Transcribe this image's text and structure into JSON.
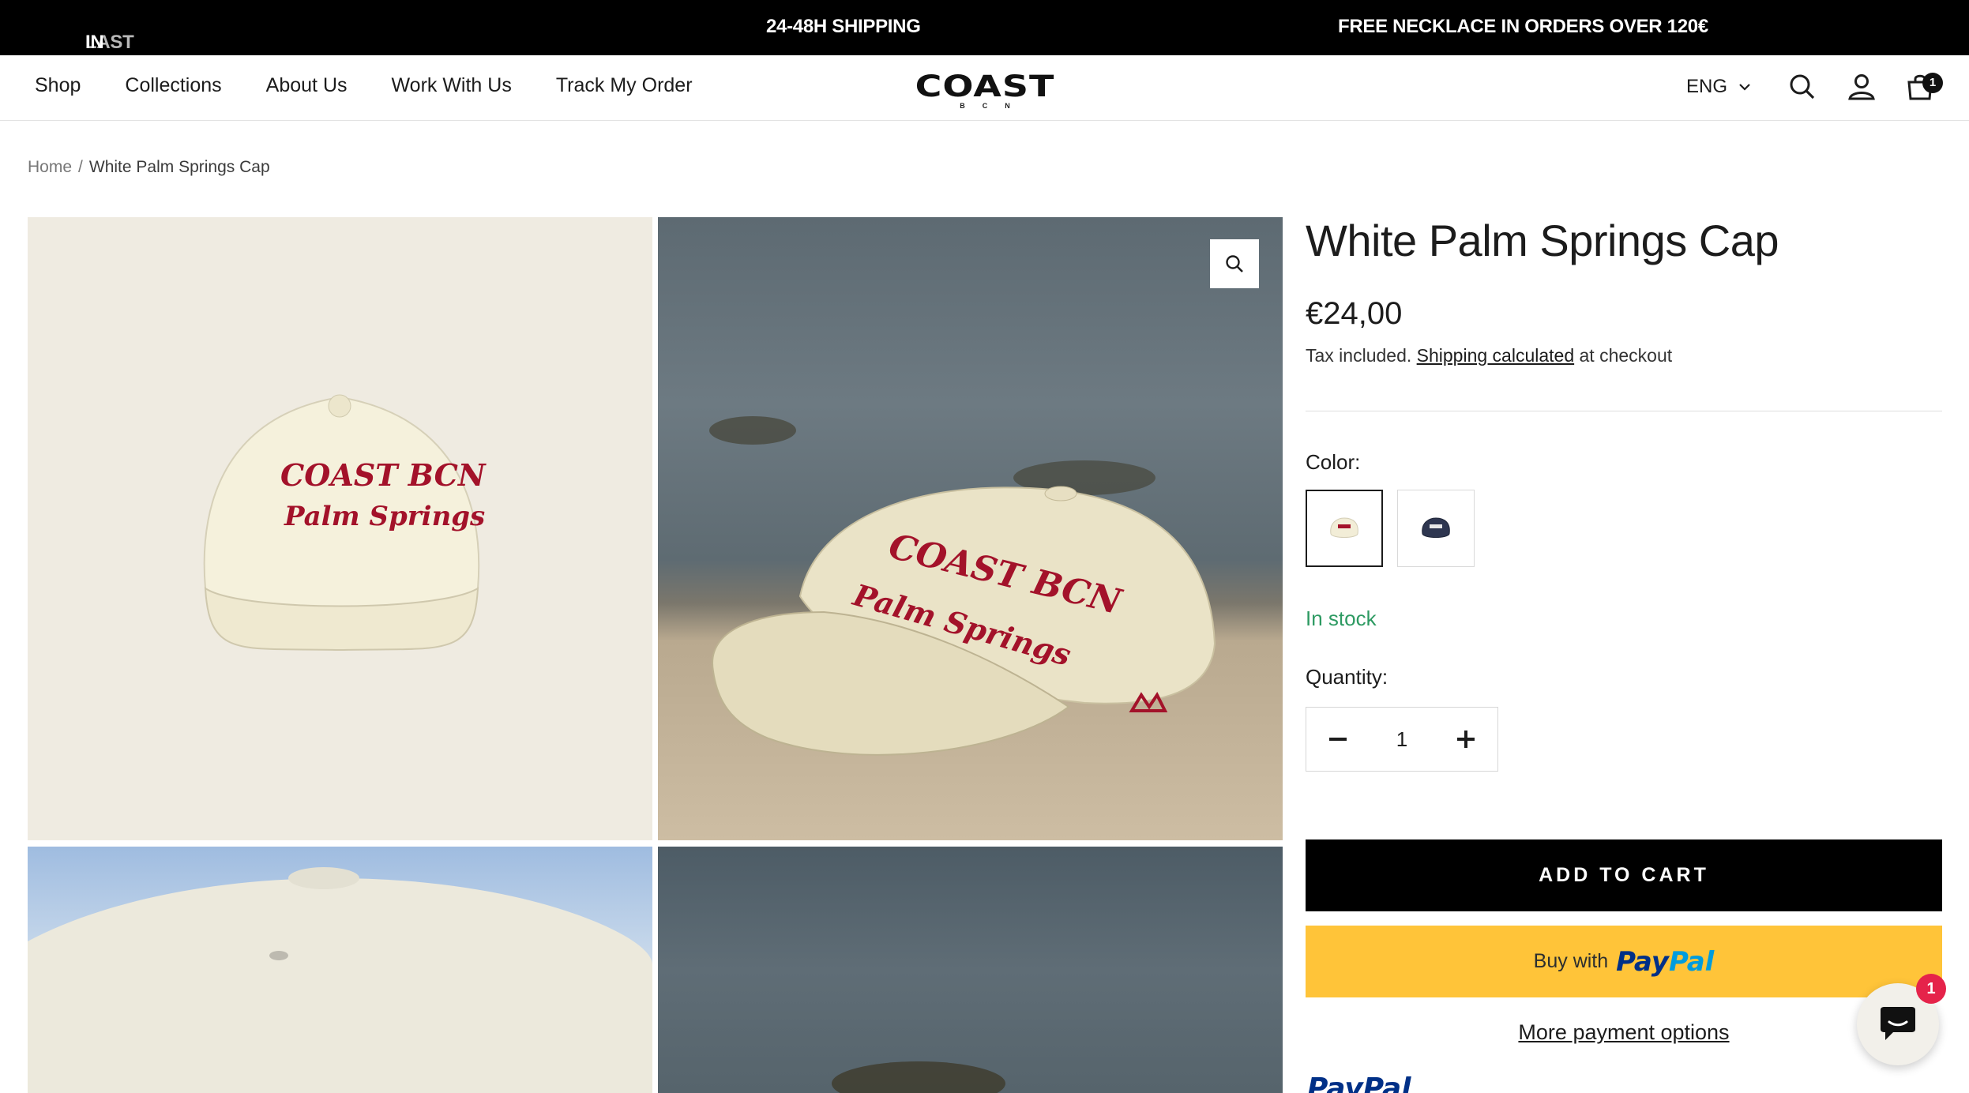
{
  "announcement": {
    "item1_dim": "LAST UNITS",
    "item1_main": " IN STOCK",
    "item2": "24-48H SHIPPING",
    "item3": "FREE NECKLACE IN ORDERS OVER 120€"
  },
  "header": {
    "nav": [
      "Shop",
      "Collections",
      "About Us",
      "Work With Us",
      "Track My Order"
    ],
    "logo_word": "COAST",
    "logo_sub": "BCN",
    "language": "ENG",
    "cart_count": "1",
    "icons": [
      "search-icon",
      "account-icon",
      "cart-icon"
    ]
  },
  "breadcrumb": {
    "home": "Home",
    "separator": "/",
    "current": "White Palm Springs Cap"
  },
  "gallery": {
    "images": [
      "cap-front-beige-background",
      "cap-on-rock-by-sea",
      "cap-top-closeup-sky",
      "sea-rocks-view"
    ],
    "embroidery_line1": "COAST BCN",
    "embroidery_line2": "Palm Springs"
  },
  "product": {
    "title": "White Palm Springs Cap",
    "price": "€24,00",
    "tax_prefix": "Tax included. ",
    "tax_link": "Shipping calculated",
    "tax_suffix": " at checkout",
    "color_label": "Color:",
    "colors": [
      "White",
      "Navy"
    ],
    "stock": "In stock",
    "quantity_label": "Quantity:",
    "quantity": "1",
    "add_to_cart": "ADD TO CART",
    "paypal_buy": "Buy with",
    "paypal_brand_1": "Pay",
    "paypal_brand_2": "Pal",
    "more_payment": "More payment options",
    "paypal_logo": "PayPal"
  },
  "chat": {
    "badge": "1"
  },
  "colors": {
    "stock_green": "#2d9a62",
    "paypal_yellow": "#ffc439",
    "embroidery_red": "#a3122a",
    "badge_red": "#e5234a"
  }
}
